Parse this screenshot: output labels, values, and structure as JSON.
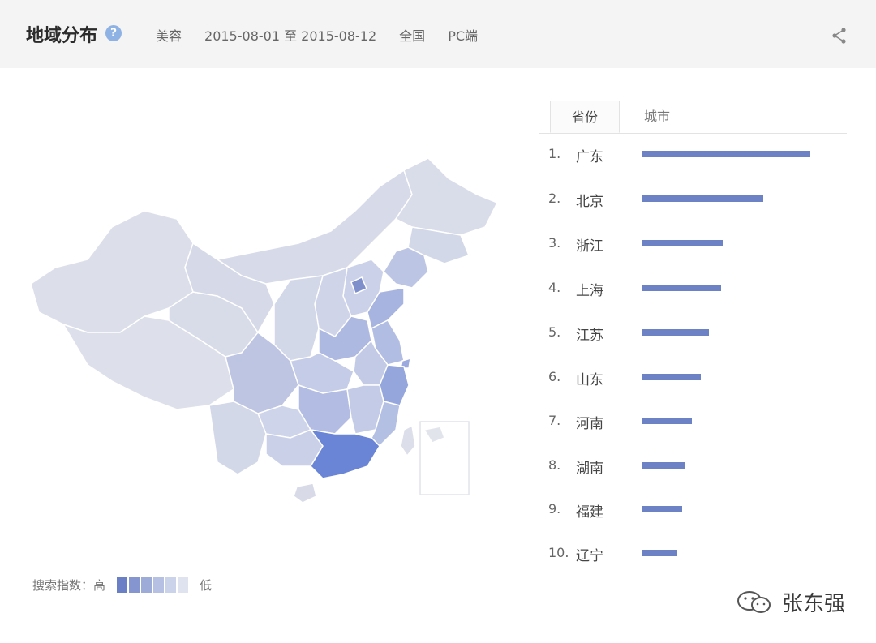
{
  "header": {
    "title": "地域分布",
    "help_icon": "help-icon",
    "filters": {
      "category": "美容",
      "date_range": "2015-08-01 至 2015-08-12",
      "region": "全国",
      "device": "PC端"
    },
    "share_icon": "share-icon"
  },
  "tabs": {
    "province": "省份",
    "city": "城市",
    "active": "province"
  },
  "ranking": [
    {
      "rank": "1.",
      "name": "广东",
      "value": 100
    },
    {
      "rank": "2.",
      "name": "北京",
      "value": 72
    },
    {
      "rank": "3.",
      "name": "浙江",
      "value": 48
    },
    {
      "rank": "4.",
      "name": "上海",
      "value": 47
    },
    {
      "rank": "5.",
      "name": "江苏",
      "value": 40
    },
    {
      "rank": "6.",
      "name": "山东",
      "value": 35
    },
    {
      "rank": "7.",
      "name": "河南",
      "value": 30
    },
    {
      "rank": "8.",
      "name": "湖南",
      "value": 26
    },
    {
      "rank": "9.",
      "name": "福建",
      "value": 24
    },
    {
      "rank": "10.",
      "name": "辽宁",
      "value": 21
    }
  ],
  "legend": {
    "label": "搜索指数：高",
    "low": "低",
    "colors": [
      "#6a7fc6",
      "#8495d0",
      "#9dabd9",
      "#b5c0e2",
      "#cbd3ea",
      "#dfe3f0"
    ]
  },
  "colors": {
    "bar": "#6d82c4",
    "map_base": "#d9dce8",
    "map_highest": "#6a85d6"
  },
  "watermark": {
    "text": "张东强",
    "icon": "wechat-icon"
  }
}
